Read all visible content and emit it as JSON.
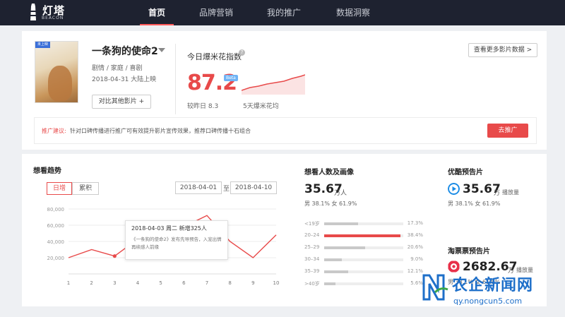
{
  "brand": {
    "name": "灯塔",
    "sub": "BEACON",
    "accent": "#e84a4a",
    "nav_bg": "#1e2230"
  },
  "nav": {
    "items": [
      "首页",
      "品牌营销",
      "我的推广",
      "数据洞察"
    ],
    "active_index": 0
  },
  "movie": {
    "poster_tag": "未上映",
    "title": "一条狗的使命2",
    "genre": "剧情 / 家庭 / 喜剧",
    "release": "2018-04-31  大陆上映",
    "compare_button": "对比其他影片  +",
    "more_button": "查看更多影片数据  >"
  },
  "popcorn_index": {
    "label": "今日爆米花指数",
    "info_icon": "?",
    "value": "87.2",
    "beta": "Beta",
    "prev_day": "较昨日 8.3",
    "five_day": "5天爆米花均"
  },
  "promo": {
    "label": "推广建议:",
    "text": "针对口碑传播进行推广可有效提升影片宣传效果，推荐口碑传播十石组合",
    "button": "去推广"
  },
  "trend": {
    "title": "想看趋势",
    "toggle_daily": "日增",
    "toggle_total": "累积",
    "date_start": "2018-04-01",
    "date_sep": "至",
    "date_end": "2018-04-10",
    "tooltip": {
      "head": "2018-04-03 周二  新增325人",
      "body": "《一条狗的使命2》发布先导预告，入宠出情再续感人前缘"
    }
  },
  "chart_data": {
    "type": "line",
    "title": "",
    "x": [
      1,
      2,
      3,
      4,
      5,
      6,
      7,
      8,
      9,
      10
    ],
    "xticks": [
      "1",
      "2",
      "3",
      "4",
      "5",
      "6",
      "7",
      "8",
      "9",
      "10"
    ],
    "series": [
      {
        "values": [
          20000,
          30000,
          22000,
          43000,
          52000,
          58000,
          72000,
          40000,
          20000,
          48000
        ]
      }
    ],
    "ylim": [
      0,
      80000
    ],
    "yticks": [
      "80,000",
      "60,000",
      "40,000",
      "20,000"
    ],
    "highlight_x": 3,
    "xlabel": "",
    "ylabel": "",
    "grid": true
  },
  "audience": {
    "title": "想看人数及画像",
    "total": "35.67",
    "total_unit": "万人",
    "gender": "男  38.1%    女  61.9%",
    "age_groups": [
      {
        "label": "<19岁",
        "pct": "17.3%",
        "value": 17.3
      },
      {
        "label": "20–24",
        "pct": "38.4%",
        "value": 38.4,
        "highlight": true
      },
      {
        "label": "25–29",
        "pct": "20.6%",
        "value": 20.6
      },
      {
        "label": "30–34",
        "pct": "9.0%",
        "value": 9.0
      },
      {
        "label": "35–39",
        "pct": "12.1%",
        "value": 12.1
      },
      {
        "label": ">40岁",
        "pct": "5.6%",
        "value": 5.6
      }
    ]
  },
  "youku": {
    "title": "优酷预告片",
    "value": "35.67",
    "unit": "万",
    "label": "播放量",
    "gender": "男  38.1%    女  61.9%",
    "icon_color": "#1a8be5"
  },
  "taopiaopiao": {
    "title": "淘票票预告片",
    "value": "2682.67",
    "unit": "万",
    "label": "播放量",
    "gender": "男  38.1%    女  61.9%",
    "icon_color": "#e8304a"
  },
  "watermark": {
    "text": "农企新闻网",
    "url": "qy.nongcun5.com"
  }
}
